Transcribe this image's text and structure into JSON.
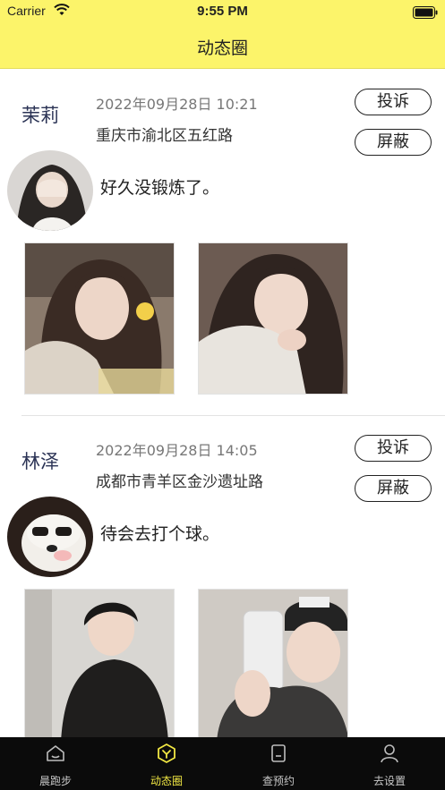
{
  "status_bar": {
    "carrier": "Carrier",
    "time": "9:55 PM"
  },
  "nav": {
    "title": "动态圈"
  },
  "posts": [
    {
      "name": "茉莉",
      "date": "2022年09月28日  10:21",
      "location": "重庆市渝北区五红路",
      "text": "好久没锻炼了。",
      "report_label": "投诉",
      "block_label": "屏蔽"
    },
    {
      "name": "林泽",
      "date": "2022年09月28日  14:05",
      "location": "成都市青羊区金沙遗址路",
      "text": "待会去打个球。",
      "report_label": "投诉",
      "block_label": "屏蔽"
    }
  ],
  "tabbar": {
    "items": [
      {
        "label": "晨跑步",
        "icon": "home-icon"
      },
      {
        "label": "动态圈",
        "icon": "moments-icon"
      },
      {
        "label": "查预约",
        "icon": "document-icon"
      },
      {
        "label": "去设置",
        "icon": "person-icon"
      }
    ],
    "active_color": "#f1e743"
  },
  "colors": {
    "header_bg": "#fcf46a",
    "tabbar_bg": "#0b0b0b"
  }
}
